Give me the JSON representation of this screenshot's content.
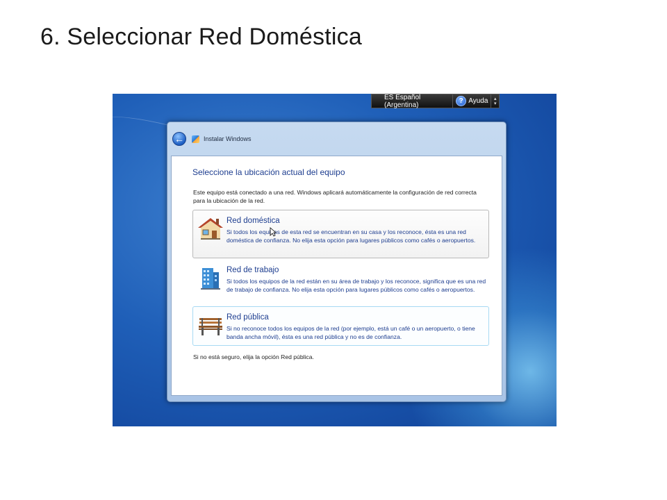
{
  "slide": {
    "title": "6. Seleccionar Red Doméstica"
  },
  "langbar": {
    "language": "ES Español (Argentina)",
    "help": "Ayuda"
  },
  "window": {
    "title": "Instalar Windows",
    "heading": "Seleccione la ubicación actual del equipo",
    "intro": "Este equipo está conectado a una red. Windows aplicará automáticamente la configuración de red correcta para la ubicación de la red.",
    "options": [
      {
        "title": "Red doméstica",
        "description": "Si todos los equipos de esta red se encuentran en su casa y los reconoce, ésta es una red doméstica de confianza. No elija esta opción para lugares públicos como cafés o aeropuertos.",
        "icon": "house-icon"
      },
      {
        "title": "Red de trabajo",
        "description": "Si todos los equipos de la red están en su área de trabajo y los reconoce, significa que es una red de trabajo de confianza. No elija esta opción para lugares públicos como cafés o aeropuertos.",
        "icon": "office-building-icon"
      },
      {
        "title": "Red pública",
        "description": "Si no reconoce todos los equipos de la red (por ejemplo, está un café o un aeropuerto, o tiene banda ancha móvil), ésta es una red pública y no es de confianza.",
        "icon": "park-bench-icon"
      }
    ],
    "footnote": "Si no está seguro, elija la opción Red pública."
  },
  "colors": {
    "heading_blue": "#1d3d8f",
    "desktop_blue": "#1f5fb8"
  }
}
